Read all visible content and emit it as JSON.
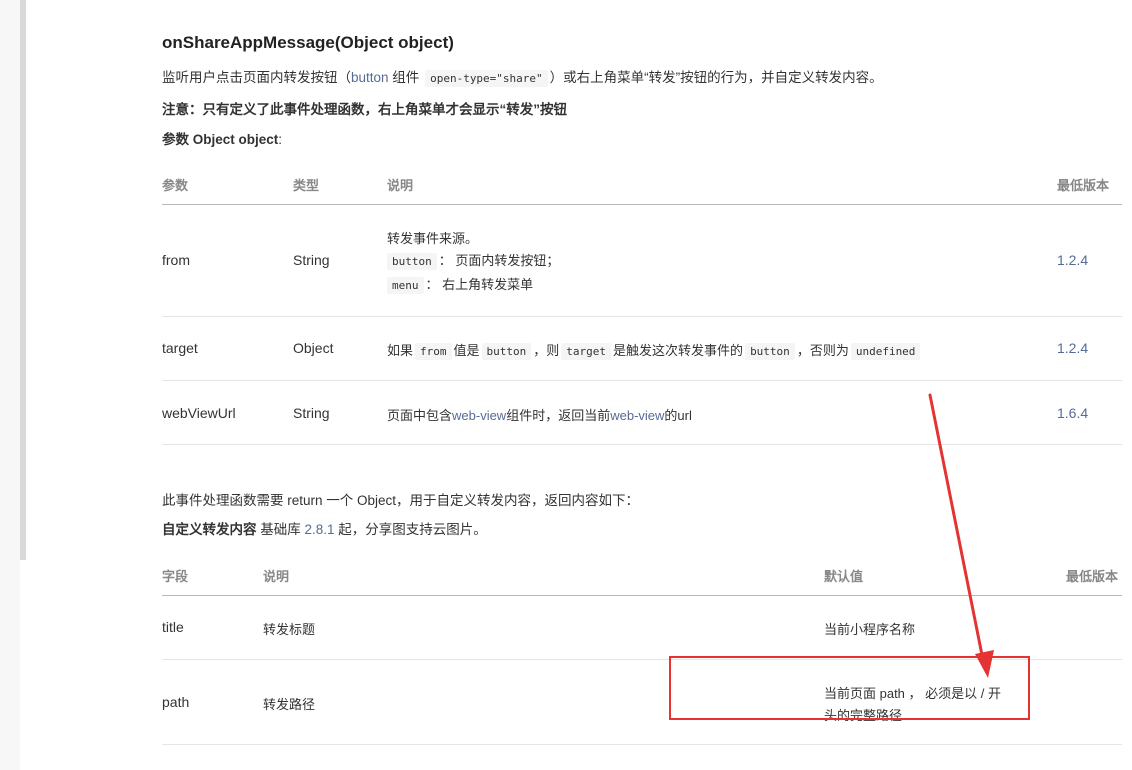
{
  "method": {
    "title": "onShareAppMessage(Object object)"
  },
  "intro": {
    "text1": "监听用户点击页面内转发按钮（",
    "link1": "button",
    "text2": " 组件",
    "code1": "open-type=\"share\"",
    "text3": "）或右上角菜单“转发”按钮的行为，并自定义转发内容。"
  },
  "note": "注意：只有定义了此事件处理函数，右上角菜单才会显示“转发”按钮",
  "params_heading": {
    "label": "参数 Object object",
    "colon": ":"
  },
  "params_table": {
    "headers": {
      "param": "参数",
      "type": "类型",
      "desc": "说明",
      "version": "最低版本"
    },
    "rows": [
      {
        "name": "from",
        "type": "String",
        "version": "1.2.4",
        "desc_line1": "转发事件来源。",
        "desc_code2": "button",
        "desc_line2": "： 页面内转发按钮；",
        "desc_code3": "menu",
        "desc_line3": "： 右上角转发菜单"
      },
      {
        "name": "target",
        "type": "Object",
        "version": "1.2.4",
        "t1": "如果",
        "c1": "from",
        "t2": "值是",
        "c2": "button",
        "t3": "，则",
        "c3": "target",
        "t4": "是触发这次转发事件的",
        "c4": "button",
        "t5": "，否则为",
        "c5": "undefined"
      },
      {
        "name": "webViewUrl",
        "type": "String",
        "version": "1.6.4",
        "t1": "页面中包含",
        "l1": "web-view",
        "t2": "组件时，返回当前",
        "l2": "web-view",
        "t3": "的url"
      }
    ]
  },
  "return_text": "此事件处理函数需要 return 一个 Object，用于自定义转发内容，返回内容如下：",
  "custom": {
    "label": "自定义转发内容",
    "text1": " 基础库 ",
    "link": "2.8.1",
    "text2": " 起，分享图支持云图片。"
  },
  "fields_table": {
    "headers": {
      "field": "字段",
      "desc": "说明",
      "default": "默认值",
      "version": "最低版本"
    },
    "rows": [
      {
        "name": "title",
        "desc": "转发标题",
        "default": "当前小程序名称"
      },
      {
        "name": "path",
        "desc": "转发路径",
        "default_line1": "当前页面 path ， 必须是以 / 开",
        "default_line2": "头的完整路径"
      }
    ]
  },
  "colors": {
    "link": "#576b95",
    "annotation": "#e53333"
  }
}
